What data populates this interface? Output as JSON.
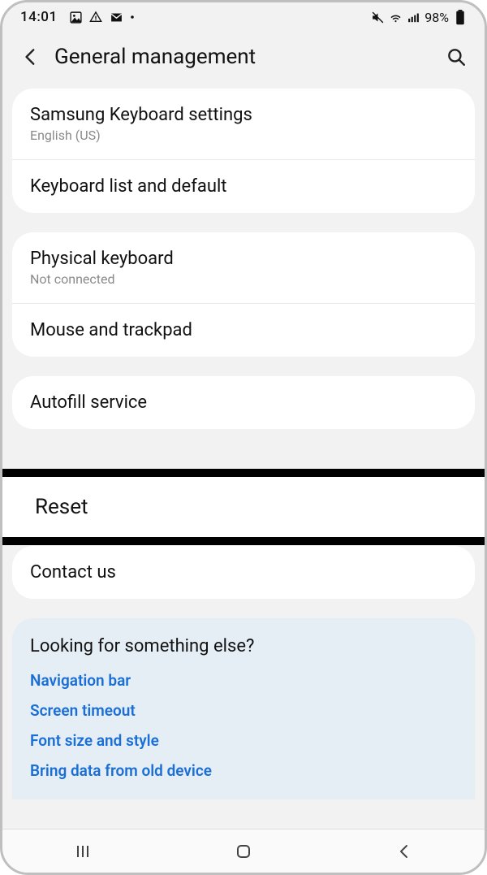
{
  "status": {
    "time": "14:01",
    "battery": "98%"
  },
  "header": {
    "title": "General management"
  },
  "group1": {
    "item0": {
      "title": "Samsung Keyboard settings",
      "sub": "English (US)"
    },
    "item1": {
      "title": "Keyboard list and default"
    }
  },
  "group2": {
    "item0": {
      "title": "Physical keyboard",
      "sub": "Not connected"
    },
    "item1": {
      "title": "Mouse and trackpad"
    }
  },
  "group3": {
    "item0": {
      "title": "Autofill service"
    }
  },
  "reset": {
    "title": "Reset"
  },
  "group4": {
    "item0": {
      "title": "Contact us"
    }
  },
  "suggest": {
    "title": "Looking for something else?",
    "link0": "Navigation bar",
    "link1": "Screen timeout",
    "link2": "Font size and style",
    "link3": "Bring data from old device"
  }
}
